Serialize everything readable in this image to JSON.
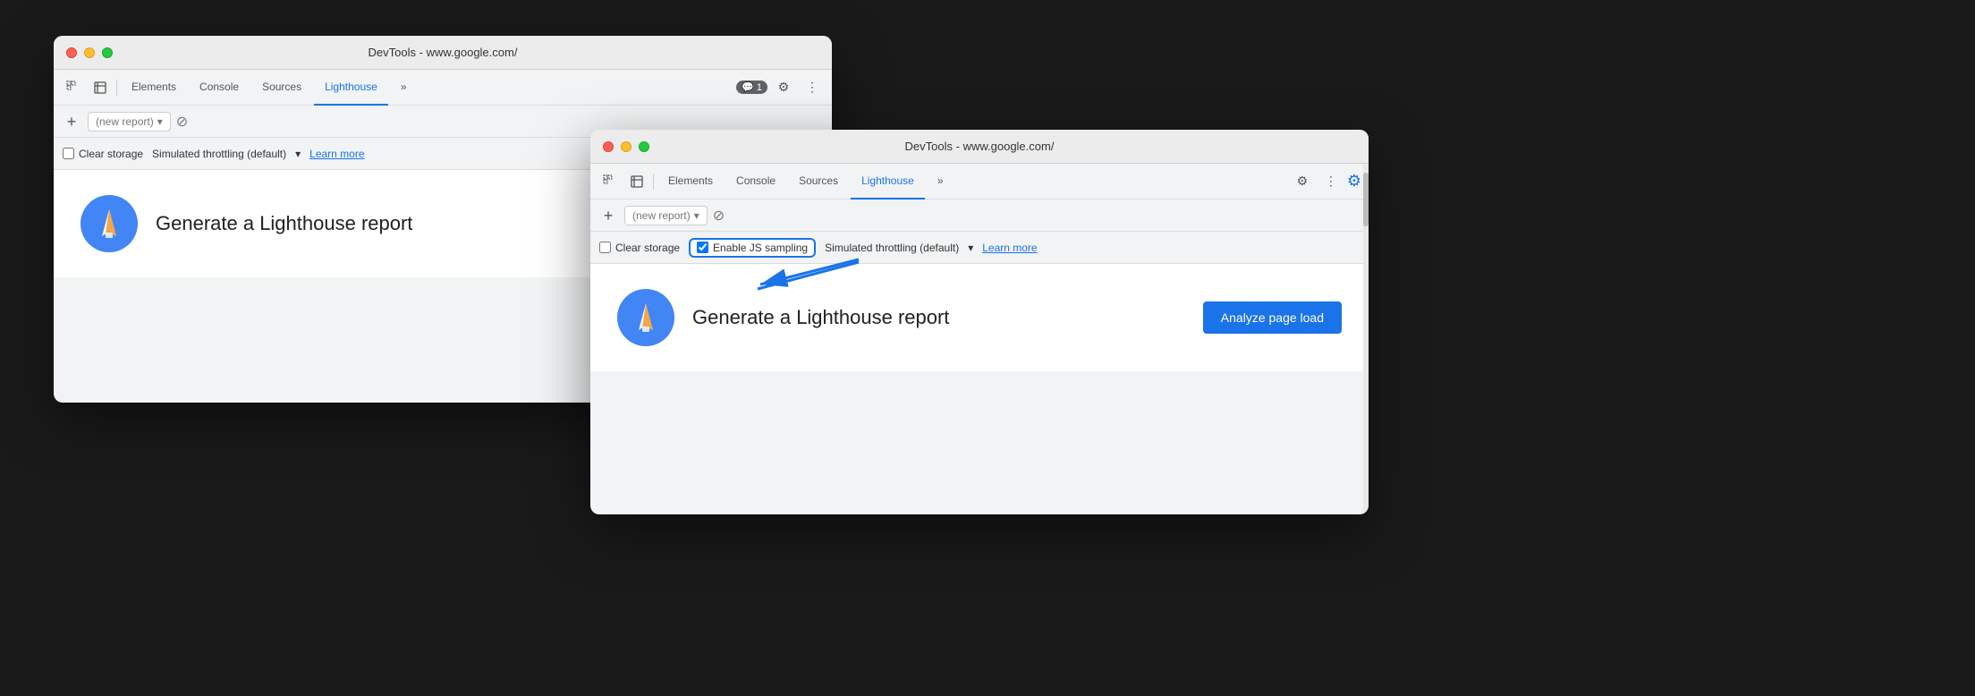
{
  "window1": {
    "title": "DevTools - www.google.com/",
    "tabs": [
      {
        "label": "Elements",
        "active": false
      },
      {
        "label": "Console",
        "active": false
      },
      {
        "label": "Sources",
        "active": false
      },
      {
        "label": "Lighthouse",
        "active": true
      },
      {
        "label": "»",
        "active": false
      }
    ],
    "toolbar_right": {
      "chat_badge": "1",
      "gear_label": "⚙",
      "more_label": "⋮"
    },
    "report_bar": {
      "add_label": "+",
      "placeholder": "(new report)",
      "cancel_label": "⊘"
    },
    "options_bar": {
      "clear_storage_label": "Clear storage",
      "throttle_label": "Simulated throttling (default)",
      "learn_more_label": "Learn more"
    },
    "main": {
      "generate_label": "Generate a Lighthouse report"
    }
  },
  "window2": {
    "title": "DevTools - www.google.com/",
    "tabs": [
      {
        "label": "Elements",
        "active": false
      },
      {
        "label": "Console",
        "active": false
      },
      {
        "label": "Sources",
        "active": false
      },
      {
        "label": "Lighthouse",
        "active": true
      },
      {
        "label": "»",
        "active": false
      }
    ],
    "toolbar_right": {
      "gear_label": "⚙",
      "more_label": "⋮",
      "gear_blue_label": "⚙"
    },
    "report_bar": {
      "add_label": "+",
      "placeholder": "(new report)",
      "cancel_label": "⊘"
    },
    "options_bar": {
      "clear_storage_label": "Clear storage",
      "js_sampling_label": "Enable JS sampling",
      "throttle_label": "Simulated throttling (default)",
      "learn_more_label": "Learn more"
    },
    "main": {
      "generate_label": "Generate a Lighthouse report",
      "analyze_btn_label": "Analyze page load"
    }
  },
  "icons": {
    "cursor": "⠿",
    "inspect": "⬜",
    "chat": "💬",
    "gear": "⚙",
    "more": "⋮",
    "add": "+",
    "cancel": "⊘",
    "dropdown": "▾"
  },
  "colors": {
    "accent_blue": "#1a73e8",
    "tab_active": "#1a73e8",
    "window_bg": "#f1f3f4",
    "main_bg": "#ffffff",
    "title_bar": "#ececec"
  }
}
